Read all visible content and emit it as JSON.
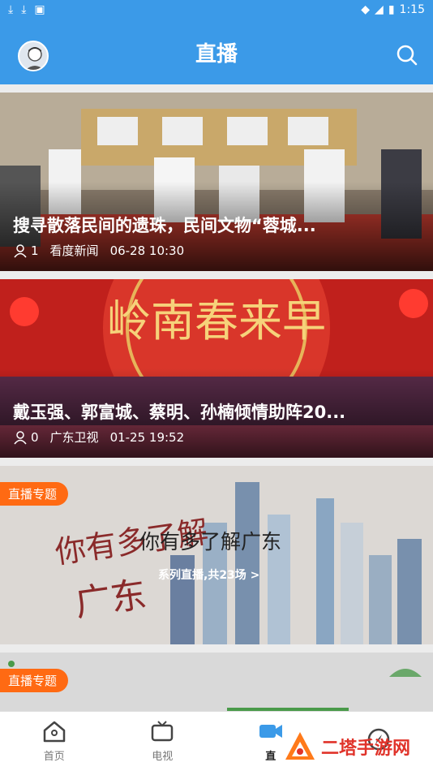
{
  "status": {
    "time": "1:15"
  },
  "header": {
    "title": "直播"
  },
  "feed": {
    "cards": [
      {
        "title": "搜寻散落民间的遗珠，民间文物“蓉城...",
        "viewers": "1",
        "source": "看度新闻",
        "time": "06-28 10:30"
      },
      {
        "title": "戴玉强、郭富城、蔡明、孙楠倾情助阵20...",
        "viewers": "0",
        "source": "广东卫视",
        "time": "01-25 19:52"
      }
    ],
    "topics": [
      {
        "tag": "直播专题",
        "title": "你有多了解广东",
        "subtitle": "系列直播,共23场 >"
      },
      {
        "tag": "直播专题"
      }
    ]
  },
  "nav": {
    "items": [
      {
        "label": "首页"
      },
      {
        "label": "电视"
      },
      {
        "label": "直"
      },
      {
        "label": ""
      }
    ]
  },
  "watermark": "二塔手游网",
  "colors": {
    "primary": "#3b9ae8",
    "tag": "#ff6a13"
  }
}
